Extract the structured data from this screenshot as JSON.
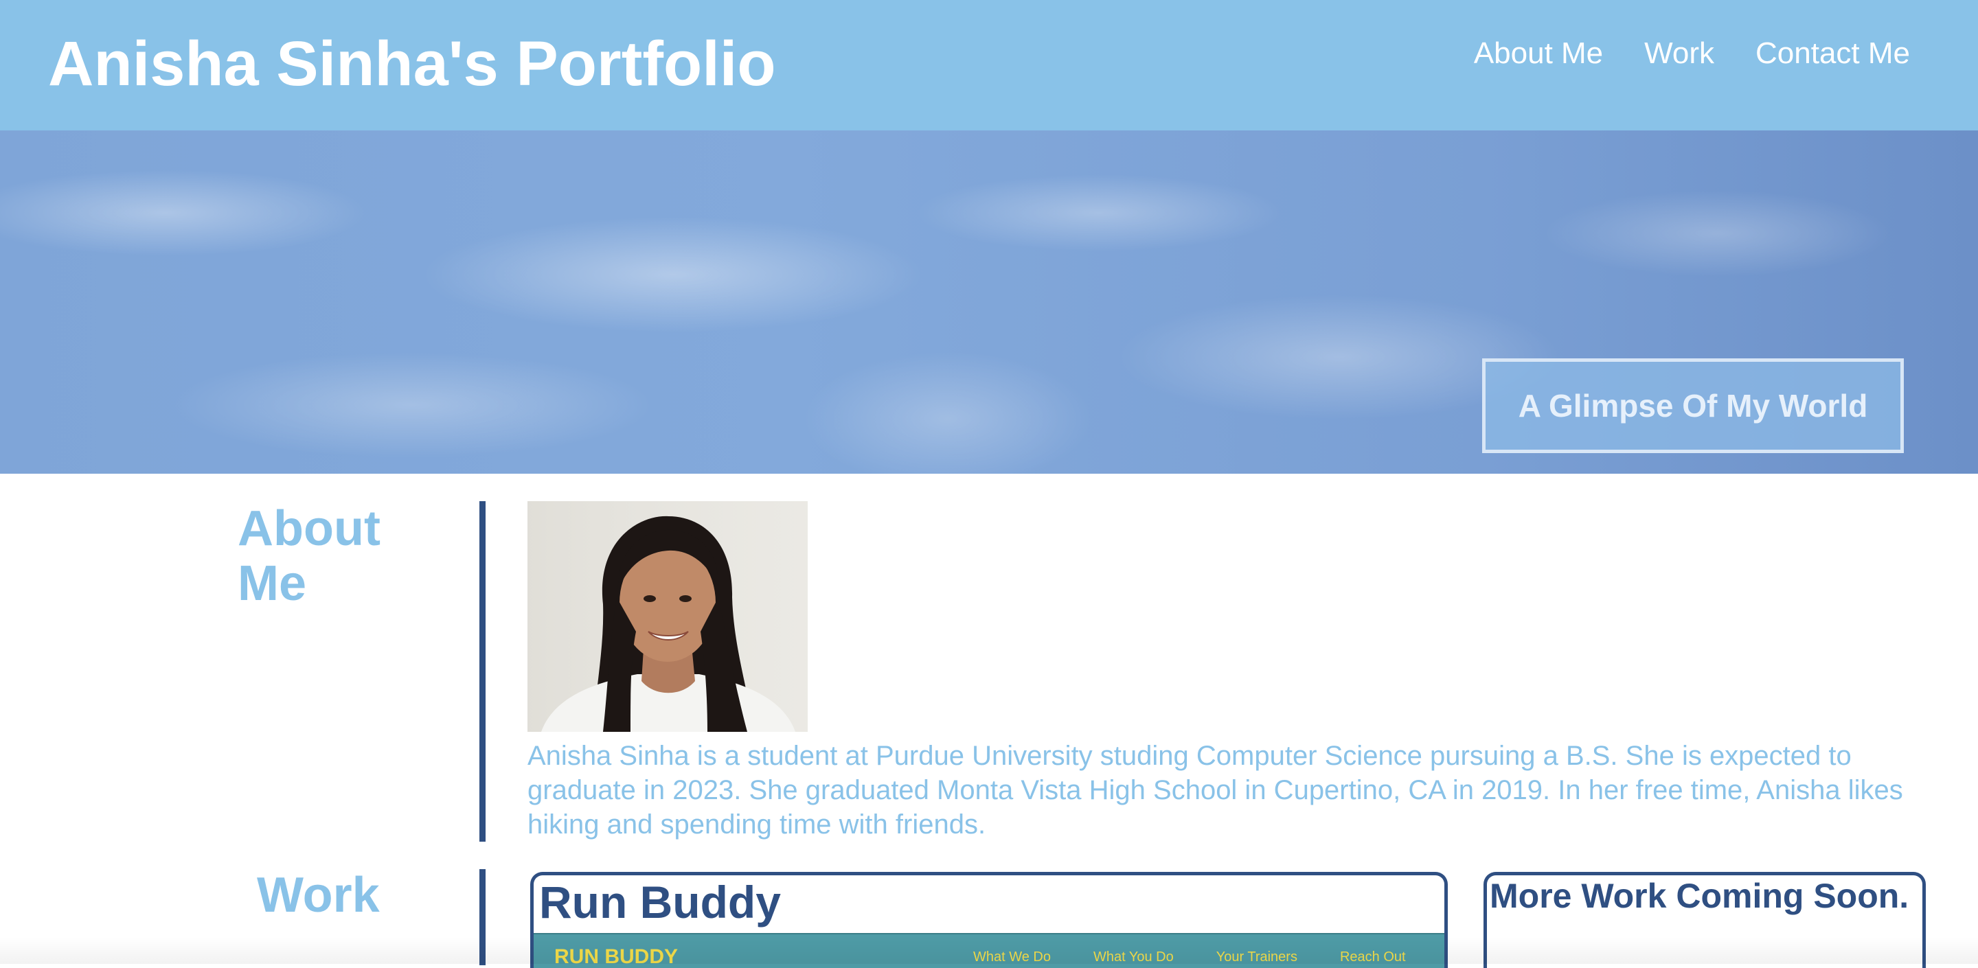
{
  "header": {
    "title": "Anisha Sinha's Portfolio",
    "nav": [
      {
        "label": "About Me"
      },
      {
        "label": "Work"
      },
      {
        "label": "Contact Me"
      }
    ]
  },
  "hero": {
    "cta_label": "A Glimpse Of My World"
  },
  "about": {
    "heading": "About Me",
    "text": "Anisha Sinha is a student at Purdue University studing Computer Science pursuing a B.S. She is expected to graduate in 2023. She graduated Monta Vista High School in Cupertino, CA in 2019. In her free time, Anisha likes hiking and spending time with friends."
  },
  "work": {
    "heading": "Work",
    "projects": [
      {
        "title": "Run Buddy",
        "preview": {
          "brand": "RUN BUDDY",
          "nav": [
            "What We Do",
            "What You Do",
            "Your Trainers",
            "Reach Out"
          ]
        }
      },
      {
        "title": "More Work Coming Soon."
      }
    ]
  },
  "colors": {
    "header_bg": "#89c2e8",
    "accent_light": "#89c2e8",
    "accent_dark": "#2f4f82"
  }
}
